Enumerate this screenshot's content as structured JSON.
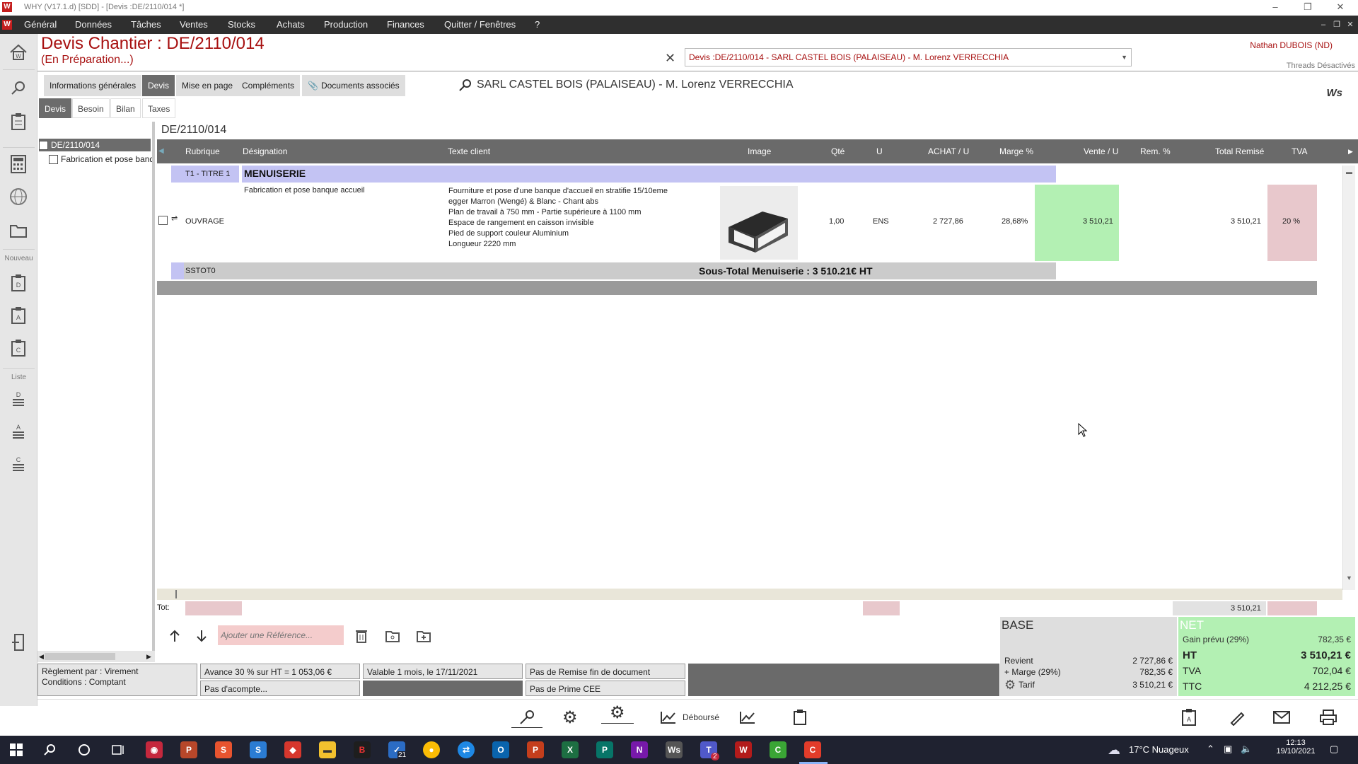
{
  "window": {
    "title": "WHY (V17.1.d)  [SDD] - [Devis :DE/2110/014 *]",
    "logo": "W"
  },
  "menu": [
    "Général",
    "Données",
    "Tâches",
    "Ventes",
    "Stocks",
    "Achats",
    "Production",
    "Finances",
    "Quitter / Fenêtres",
    "?"
  ],
  "sidebar": {
    "label_new": "Nouveau",
    "label_list": "Liste"
  },
  "header": {
    "title": "Devis  Chantier : DE/2110/014",
    "status": "(En Préparation...)",
    "selector": "Devis :DE/2110/014 - SARL CASTEL BOIS  (PALAISEAU) - M. Lorenz VERRECCHIA",
    "user": "Nathan DUBOIS (ND)",
    "threads": "Threads Désactivés",
    "client": "SARL CASTEL BOIS  (PALAISEAU) - M. Lorenz VERRECCHIA",
    "brand": "Ws"
  },
  "tabs": [
    "Informations générales",
    "Devis",
    "Mise en page",
    "Compléments",
    "Documents associés"
  ],
  "subtabs": [
    "Devis",
    "Besoin",
    "Bilan",
    "Taxes"
  ],
  "tree": {
    "root": "DE/2110/014",
    "child": "Fabrication et pose banque accueil"
  },
  "doc_number": "DE/2110/014",
  "grid": {
    "headers": {
      "rubrique": "Rubrique",
      "designation": "Désignation",
      "texte": "Texte client",
      "image": "Image",
      "qte": "Qté",
      "u": "U",
      "achat": "ACHAT / U",
      "marge": "Marge %",
      "vente": "Vente / U",
      "rem": "Rem. %",
      "total": "Total Remisé",
      "tva": "TVA"
    },
    "title_row": {
      "rubrique": "T1 - TITRE 1",
      "designation": "MENUISERIE"
    },
    "item_row": {
      "rubrique": "OUVRAGE",
      "designation": "Fabrication et pose banque accueil",
      "texte": [
        "Fourniture et pose d'une banque d'accueil en stratifie 15/10eme",
        "egger Marron (Wengé) & Blanc - Chant abs",
        "Plan de travail à 750 mm - Partie supérieure à 1100 mm",
        "Espace de rangement en caisson invisible",
        "Pied de support couleur Aluminium",
        "Longueur 2220 mm"
      ],
      "qte": "1,00",
      "u": "ENS",
      "achat": "2 727,86",
      "marge": "28,68%",
      "vente": "3 510,21",
      "total": "3 510,21",
      "tva": "20 %"
    },
    "subtotal_row": {
      "rubrique": "SSTOT0",
      "label": "Sous-Total Menuiserie : 3 510.21€ HT"
    },
    "tot_label": "Tot:",
    "tot_value": "3 510,21"
  },
  "toolbar": {
    "add_ref_placeholder": "Ajouter une Référence..."
  },
  "base": {
    "title": "BASE",
    "revient_label": "Revient",
    "revient": "2 727,86 €",
    "marge_label": "+ Marge (29%)",
    "marge": "782,35 €",
    "tarif_label": "Tarif",
    "tarif": "3 510,21 €"
  },
  "net": {
    "title": "NET",
    "gain_label": "Gain prévu (29%)",
    "gain": "782,35 €",
    "ht_label": "HT",
    "ht": "3 510,21 €",
    "tva_label": "TVA",
    "tva": "702,04 €",
    "ttc_label": "TTC",
    "ttc": "4 212,25 €"
  },
  "footer": {
    "reglement": "Règlement par : Virement",
    "conditions": "Conditions : Comptant",
    "avance": "Avance 30 % sur HT =   1 053,06 €",
    "acompte": "Pas d'acompte...",
    "valable": "Valable 1 mois, le 17/11/2021",
    "remise": "Pas de Remise fin de document",
    "prime": "Pas de Prime CEE"
  },
  "bottombar": {
    "debourse": "Déboursé"
  },
  "taskbar": {
    "weather": "17°C  Nuageux",
    "time": "12:13",
    "date": "19/10/2021",
    "teams_badge": "21",
    "teams2_badge": "2"
  },
  "colors": {
    "accent": "#a71010",
    "vente_bg": "#b3f0b3",
    "tva_bg": "#e8c8cc",
    "title_row": "#c3c3f3"
  }
}
